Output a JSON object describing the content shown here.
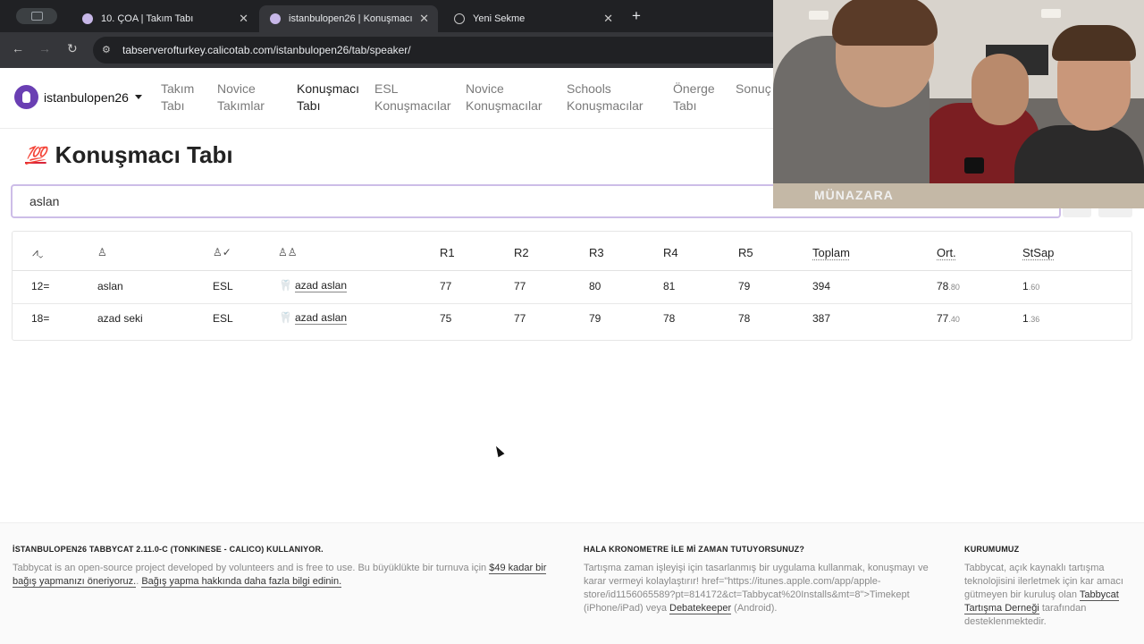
{
  "browser": {
    "tabs": [
      {
        "title": "10. ÇOA | Takım Tabı"
      },
      {
        "title": "istanbulopen26 | Konuşmacı"
      },
      {
        "title": "Yeni Sekme"
      }
    ],
    "url": "tabserverofturkey.calicotab.com/istanbulopen26/tab/speaker/"
  },
  "site": {
    "brand": "istanbulopen26",
    "nav": [
      {
        "line1": "Takım",
        "line2": "Tabı"
      },
      {
        "line1": "Novice",
        "line2": "Takımlar"
      },
      {
        "line1": "Konuşmacı",
        "line2": "Tabı"
      },
      {
        "line1": "ESL",
        "line2": "Konuşmacılar"
      },
      {
        "line1": "Novice",
        "line2": "Konuşmacılar"
      },
      {
        "line1": "Schools",
        "line2": "Konuşmacılar"
      },
      {
        "line1": "Önerge",
        "line2": "Tabı"
      },
      {
        "line1": "Sonuç",
        "line2": ""
      }
    ]
  },
  "page": {
    "emoji": "💯",
    "title": "Konuşmacı Tabı",
    "search_value": "aslan"
  },
  "table": {
    "headers": [
      "R1",
      "R2",
      "R3",
      "R4",
      "R5",
      "Toplam",
      "Ort.",
      "StSap"
    ],
    "rows": [
      {
        "rank": "12=",
        "name": "aslan",
        "category": "ESL",
        "team": "azad aslan",
        "r1": "77",
        "r2": "77",
        "r3": "80",
        "r4": "81",
        "r5": "79",
        "total": "394",
        "avg_int": "78",
        "avg_frac": ".80",
        "sd_int": "1",
        "sd_frac": ".60"
      },
      {
        "rank": "18=",
        "name": "azad seki",
        "category": "ESL",
        "team": "azad aslan",
        "r1": "75",
        "r2": "77",
        "r3": "79",
        "r4": "78",
        "r5": "78",
        "total": "387",
        "avg_int": "77",
        "avg_frac": ".40",
        "sd_int": "1",
        "sd_frac": ".36"
      }
    ]
  },
  "webcam": {
    "hoodie_text": "MÜNAZARA"
  },
  "footer": {
    "col1": {
      "heading": "İSTANBULOPEN26 TABBYCAT 2.11.0-C (TONKINESE - CALICO) KULLANIYOR.",
      "text1": "Tabbycat is an open-source project developed by volunteers and is free to use. Bu büyüklükte bir turnuva için ",
      "link1": "$49 kadar bir bağış yapmanızı öneriyoruz.",
      "text2": ". ",
      "link2": "Bağış yapma hakkında daha fazla bilgi edinin."
    },
    "col2": {
      "heading": "HALA KRONOMETRE İLE Mİ ZAMAN TUTUYORSUNUZ?",
      "text1": "Tartışma zaman işleyişi için tasarlanmış bir uygulama kullanmak, konuşmayı ve karar vermeyi kolaylaştırır! href=\"https://itunes.apple.com/app/apple-store/id1156065589?pt=814172&ct=Tabbycat%20Installs&mt=8\">Timekept (iPhone/iPad) veya ",
      "link1": "Debatekeeper",
      "text2": " (Android)."
    },
    "col3": {
      "heading": "KURUMUMUZ",
      "text1": "Tabbycat, açık kaynaklı tartışma teknolojisini ilerletmek için kar amacı gütmeyen bir kuruluş olan ",
      "link1": "Tabbycat Tartışma Derneği",
      "text2": " tarafından desteklenmektedir."
    }
  }
}
